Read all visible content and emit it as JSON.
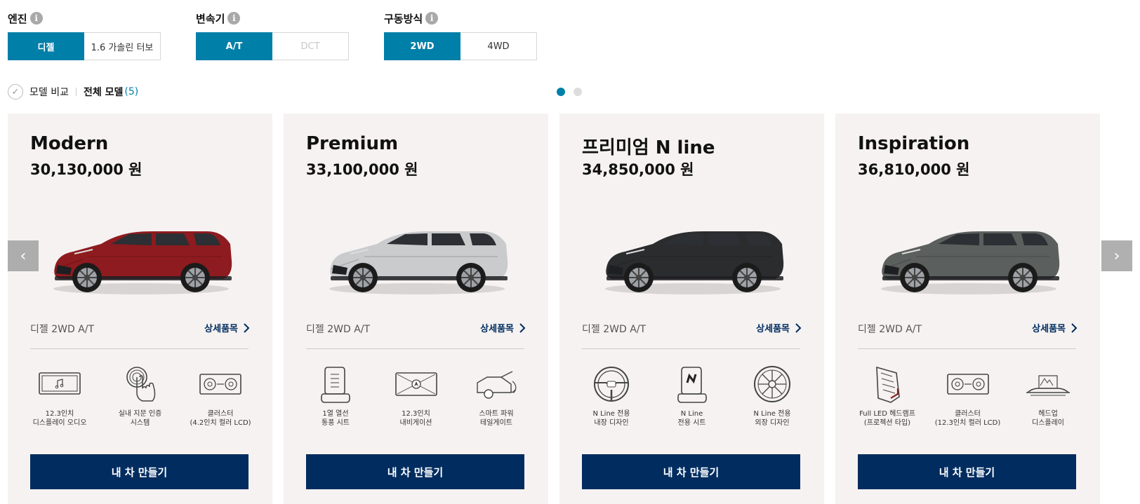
{
  "filters": {
    "engine": {
      "title": "엔진",
      "options": [
        {
          "label": "디젤",
          "state": "active"
        },
        {
          "label": "1.6 가솔린 터보",
          "state": "default"
        }
      ]
    },
    "transmission": {
      "title": "변속기",
      "options": [
        {
          "label": "A/T",
          "state": "active"
        },
        {
          "label": "DCT",
          "state": "disabled"
        }
      ]
    },
    "drive": {
      "title": "구동방식",
      "options": [
        {
          "label": "2WD",
          "state": "active"
        },
        {
          "label": "4WD",
          "state": "default"
        }
      ]
    },
    "info_glyph": "i"
  },
  "compare": {
    "compare_label": "모델 비교",
    "all_label": "전체 모델",
    "all_count": "(5)"
  },
  "pagination": {
    "total": 2,
    "active": 1
  },
  "colors": {
    "accent": "#007fa8",
    "navy": "#002c5f",
    "card_bg": "#f5f2f1"
  },
  "cards": [
    {
      "name": "Modern",
      "price": "30,130,000 원",
      "car_color": "#8e1b1f",
      "spec": "디젤 2WD A/T",
      "detail_label": "상세품목",
      "features": [
        {
          "icon": "display-audio-icon",
          "label": "12.3인치\n디스플레이 오디오"
        },
        {
          "icon": "fingerprint-icon",
          "label": "실내 지문 인증\n시스템"
        },
        {
          "icon": "cluster-icon",
          "label": "클러스터\n(4.2인치 컬러 LCD)"
        }
      ],
      "button_label": "내 차 만들기"
    },
    {
      "name": "Premium",
      "price": "33,100,000 원",
      "car_color": "#c9cbcd",
      "spec": "디젤 2WD A/T",
      "detail_label": "상세품목",
      "features": [
        {
          "icon": "ventilated-seat-icon",
          "label": "1열 열선\n통풍 시트"
        },
        {
          "icon": "navigation-icon",
          "label": "12.3인치\n내비게이션"
        },
        {
          "icon": "power-tailgate-icon",
          "label": "스마트 파워\n테일게이트"
        }
      ],
      "button_label": "내 차 만들기"
    },
    {
      "name": "프리미엄 N line",
      "price": "34,850,000 원",
      "car_color": "#2b2c2e",
      "spec": "디젤 2WD A/T",
      "detail_label": "상세품목",
      "features": [
        {
          "icon": "steering-wheel-icon",
          "label": "N Line 전용\n내장 디자인"
        },
        {
          "icon": "n-seat-icon",
          "label": "N Line\n전용 시트"
        },
        {
          "icon": "wheel-icon",
          "label": "N Line 전용\n외장 디자인"
        }
      ],
      "button_label": "내 차 만들기"
    },
    {
      "name": "Inspiration",
      "price": "36,810,000 원",
      "car_color": "#5b5f5d",
      "spec": "디젤 2WD A/T",
      "detail_label": "상세품목",
      "features": [
        {
          "icon": "headlamp-icon",
          "label": "Full LED 헤드램프\n(프로젝션 타입)"
        },
        {
          "icon": "cluster-icon",
          "label": "클러스터\n(12.3인치 컬러 LCD)"
        },
        {
          "icon": "hud-icon",
          "label": "헤드업\n디스플레이"
        }
      ],
      "button_label": "내 차 만들기"
    }
  ],
  "arrows": {
    "prev": "‹",
    "next": "›"
  }
}
